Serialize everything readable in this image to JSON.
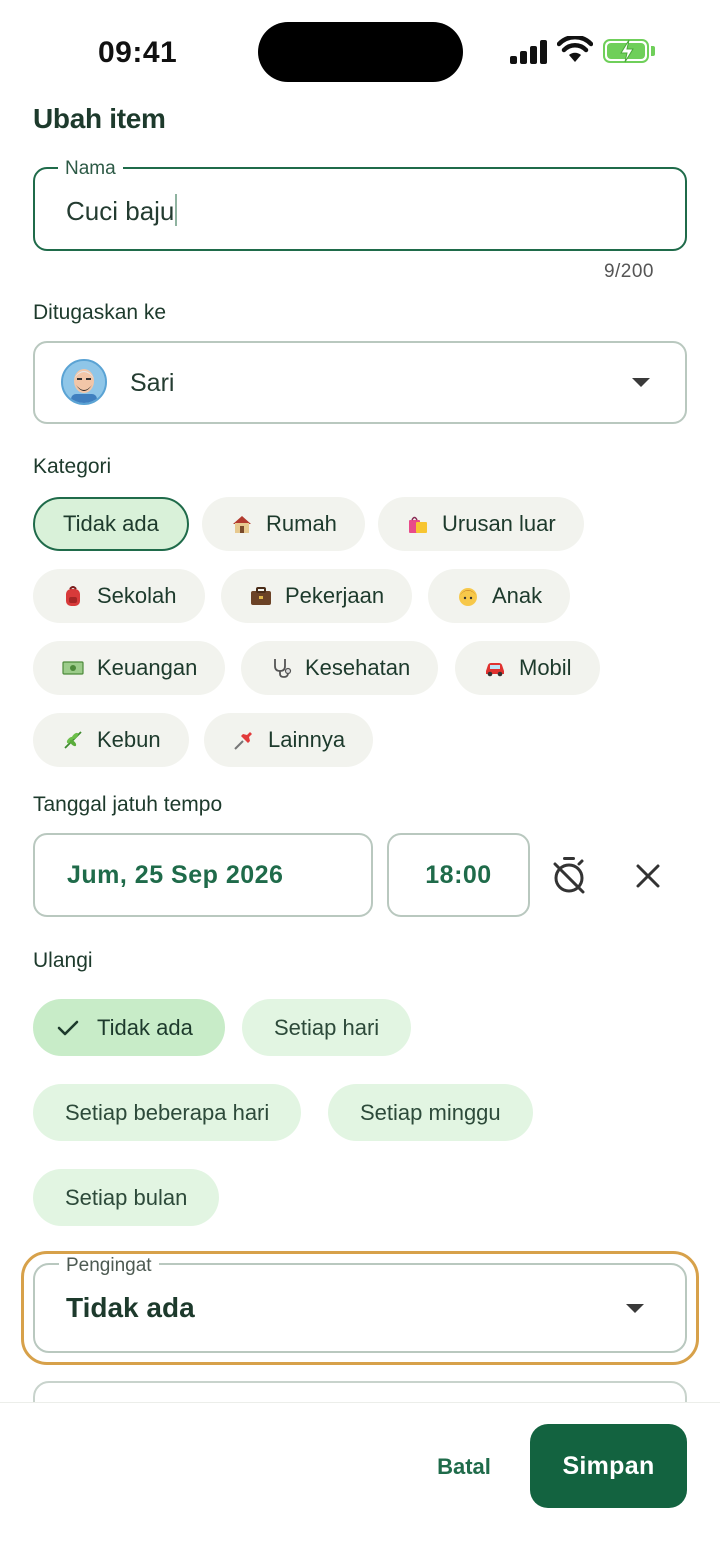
{
  "status_bar": {
    "time": "09:41"
  },
  "dialog": {
    "title": "Ubah item",
    "name_field": {
      "label": "Nama",
      "value": "Cuci baju",
      "counter": "9/200"
    },
    "assignee": {
      "label": "Ditugaskan ke",
      "value": "Sari",
      "avatar_icon": "person-avatar-icon"
    },
    "category": {
      "label": "Kategori",
      "selected": "Tidak ada",
      "options": [
        {
          "label": "Tidak ada",
          "icon": ""
        },
        {
          "label": "Rumah",
          "icon": "house-icon"
        },
        {
          "label": "Urusan luar",
          "icon": "shopping-bags-icon"
        },
        {
          "label": "Sekolah",
          "icon": "backpack-icon"
        },
        {
          "label": "Pekerjaan",
          "icon": "briefcase-icon"
        },
        {
          "label": "Anak",
          "icon": "child-icon"
        },
        {
          "label": "Keuangan",
          "icon": "money-icon"
        },
        {
          "label": "Kesehatan",
          "icon": "stethoscope-icon"
        },
        {
          "label": "Mobil",
          "icon": "car-icon"
        },
        {
          "label": "Kebun",
          "icon": "herb-icon"
        },
        {
          "label": "Lainnya",
          "icon": "pushpin-icon"
        }
      ]
    },
    "due": {
      "label": "Tanggal jatuh tempo",
      "date": "Jum, 25 Sep 2026",
      "time": "18:00",
      "timer_icon": "timer-off-icon",
      "clear_icon": "close-icon"
    },
    "repeat": {
      "label": "Ulangi",
      "selected": "Tidak ada",
      "options": [
        "Tidak ada",
        "Setiap hari",
        "Setiap beberapa hari",
        "Setiap minggu",
        "Setiap bulan"
      ]
    },
    "reminder": {
      "label": "Pengingat",
      "value": "Tidak ada"
    },
    "actions": {
      "cancel": "Batal",
      "save": "Simpan"
    }
  },
  "colors": {
    "primary": "#136340",
    "accent_green": "#1f6b4a",
    "chip_selected": "#d9f1d9",
    "focus": "#d7a14a"
  }
}
